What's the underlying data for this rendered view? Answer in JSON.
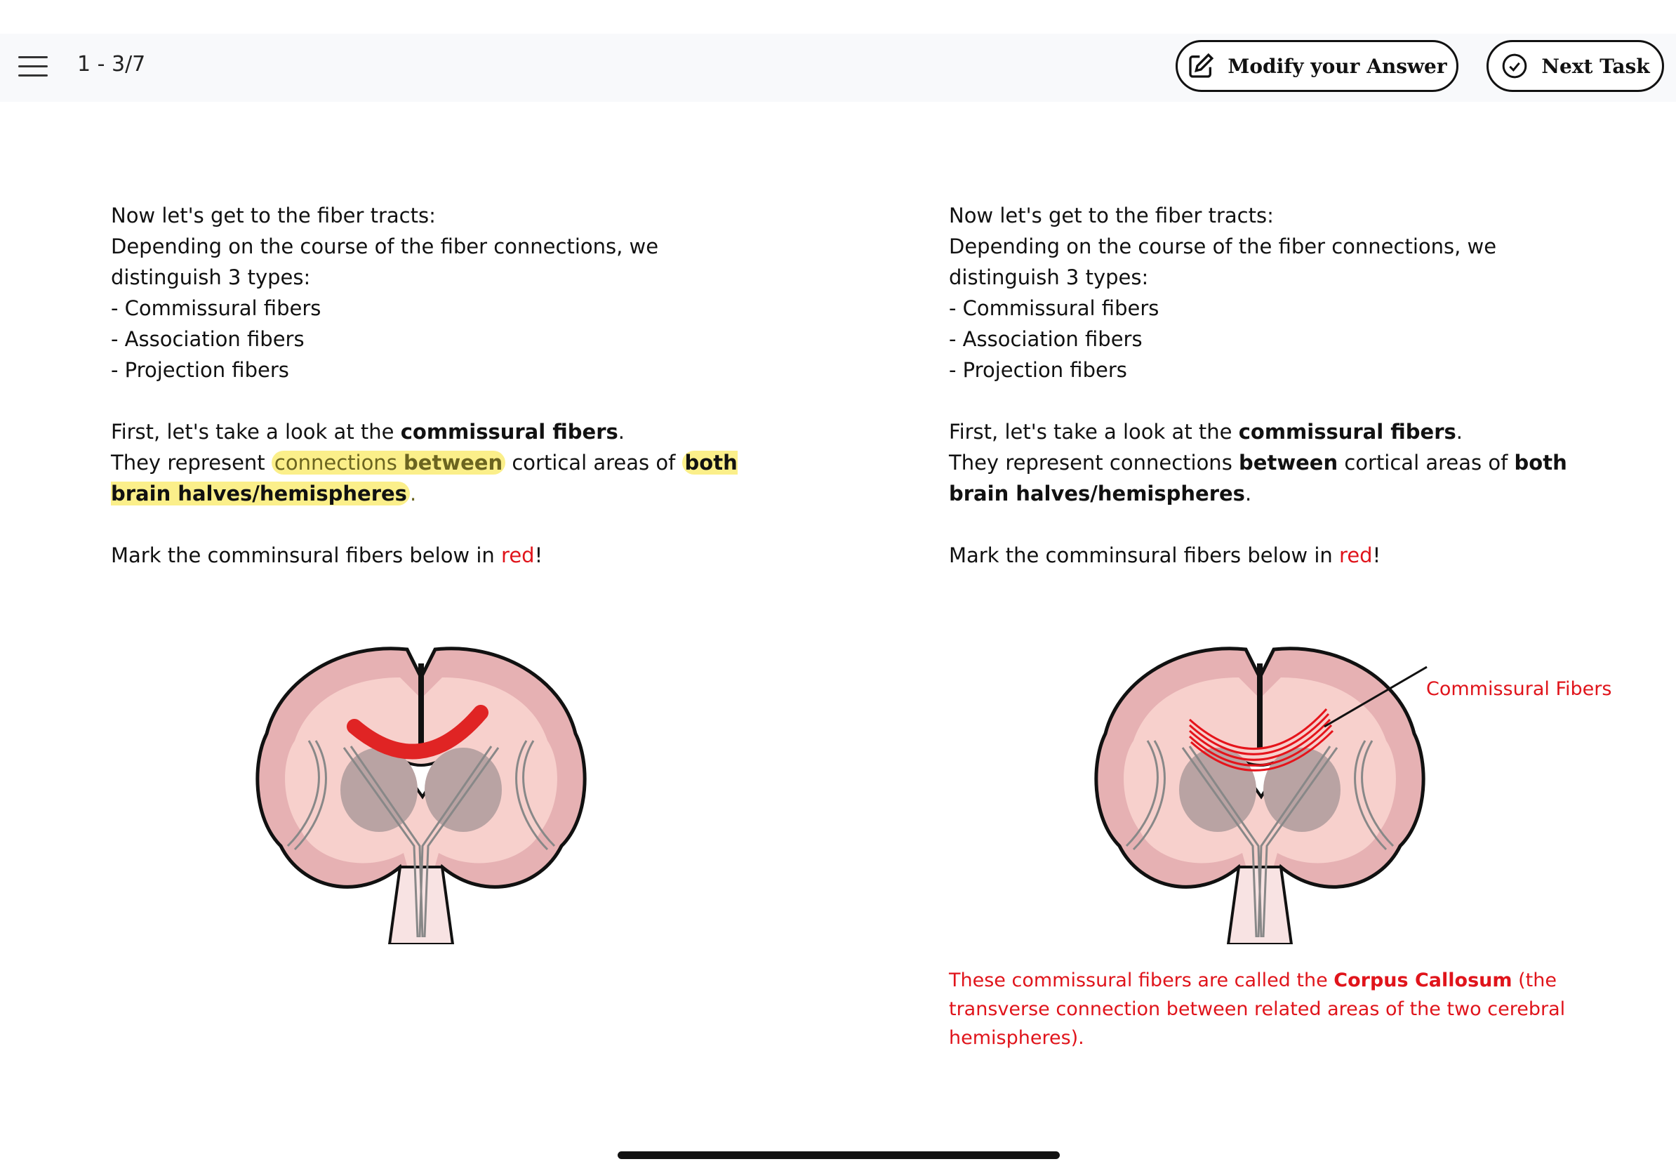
{
  "header": {
    "progress": "1 - 3/7",
    "modify_label": "Modify your Answer",
    "next_label": "Next Task",
    "menu_icon": "hamburger-icon",
    "modify_icon": "edit-icon",
    "next_icon": "check-circle-icon"
  },
  "content": {
    "intro1": "Now let's get to the fiber tracts:",
    "intro2": "Depending on the course of the fiber connections, we distinguish 3 types:",
    "types": [
      "- Commissural fibers",
      "- Association fibers",
      "- Projection fibers"
    ],
    "first_a": "First, let's take a look at the ",
    "first_b": "commissural fibers",
    "first_c": ".",
    "rep_a": "They represent ",
    "rep_b": "connections ",
    "rep_c": "between",
    "rep_d": " cortical areas of ",
    "rep_e": "both brain halves/hemispheres",
    "rep_f": ".",
    "mark_a": "Mark the comminsural fibers below in ",
    "mark_b": "red",
    "mark_c": "!"
  },
  "answer": {
    "label": "Commissural Fibers",
    "note_a": "These commissural fibers are called the ",
    "note_b": "Corpus Callosum",
    "note_c": " (the transverse connection between related areas of the two cerebral hemispheres)."
  },
  "colors": {
    "accent_red": "#e0141b",
    "highlight": "#fbef8a",
    "brain": "#e8b4b4"
  }
}
